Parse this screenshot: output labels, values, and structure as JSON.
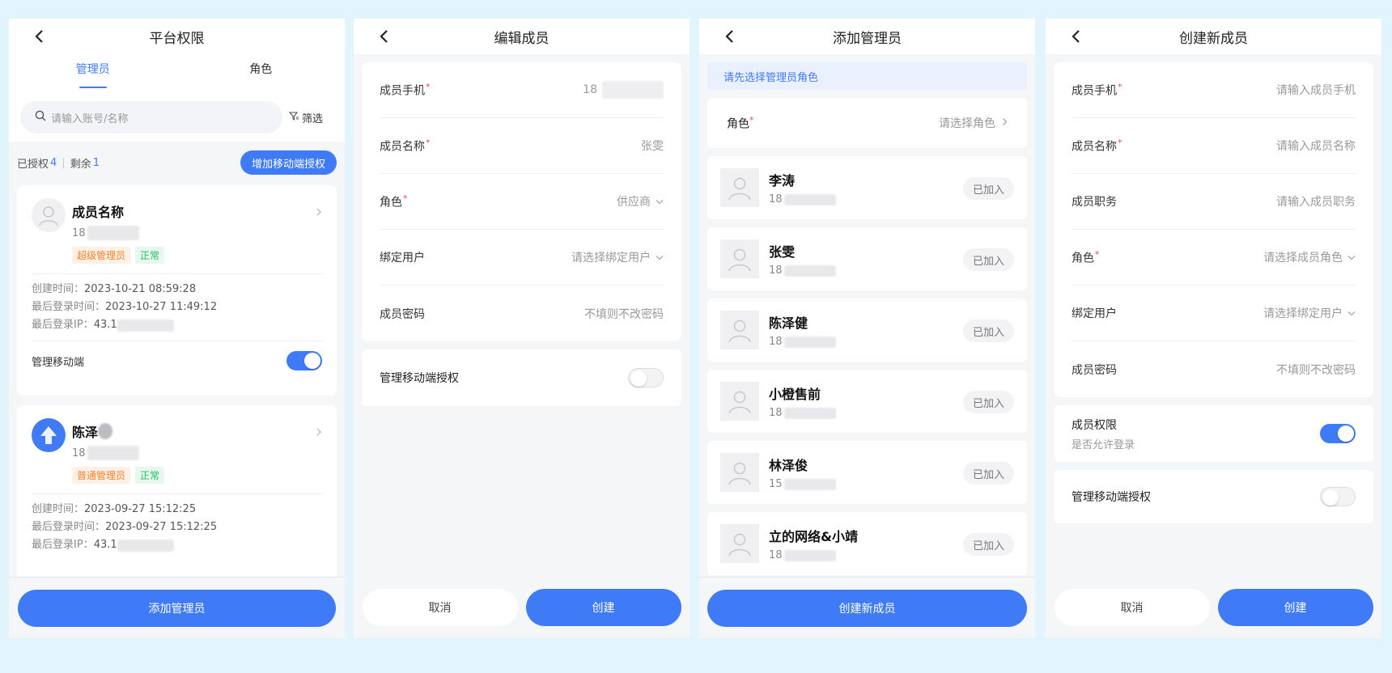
{
  "colors": {
    "accent": "#3f7bf7",
    "background": "#e2f4fc",
    "required": "#f04b4b",
    "tag_orange": "#f5812a",
    "tag_green": "#1fbf63"
  },
  "screen1": {
    "title": "平台权限",
    "tabs": [
      {
        "label": "管理员"
      },
      {
        "label": "角色"
      }
    ],
    "search_placeholder": "请输入账号/名称",
    "filter_label": "筛选",
    "authorized_label": "已授权",
    "authorized_count": "4",
    "remaining_label": "剩余",
    "remaining_count": "1",
    "add_mobile_button": "增加移动端授权",
    "cards": [
      {
        "name": "成员名称",
        "phone": "18",
        "tags": [
          "超级管理员",
          "正常"
        ],
        "created_label": "创建时间：",
        "created": "2023-10-21 08:59:28",
        "last_login_label": "最后登录时间：",
        "last_login": "2023-10-27 11:49:12",
        "ip_label": "最后登录IP：",
        "ip": "43.1",
        "mobile_label": "管理移动端",
        "mobile_enabled": true
      },
      {
        "name": "陈泽",
        "phone": "18",
        "tags": [
          "普通管理员",
          "正常"
        ],
        "created_label": "创建时间：",
        "created": "2023-09-27 15:12:25",
        "last_login_label": "最后登录时间：",
        "last_login": "2023-09-27 15:12:25",
        "ip_label": "最后登录IP：",
        "ip": "43.1"
      }
    ],
    "bottom_button": "添加管理员"
  },
  "screen2": {
    "title": "编辑成员",
    "fields": [
      {
        "label": "成员手机",
        "required": "*",
        "value": "18"
      },
      {
        "label": "成员名称",
        "required": "*",
        "value": "张雯"
      },
      {
        "label": "角色",
        "required": "*",
        "value": "供应商"
      },
      {
        "label": "绑定用户",
        "value": "请选择绑定用户"
      },
      {
        "label": "成员密码",
        "value": "不填则不改密码"
      }
    ],
    "mobile_auth_label": "管理移动端授权",
    "mobile_auth_enabled": false,
    "cancel": "取消",
    "create": "创建"
  },
  "screen3": {
    "title": "添加管理员",
    "notice": "请先选择管理员角色",
    "role_label": "角色",
    "role_required": "*",
    "role_placeholder": "请选择角色",
    "members": [
      {
        "name": "李涛",
        "phone": "18",
        "status": "已加入"
      },
      {
        "name": "张雯",
        "phone": "18",
        "status": "已加入"
      },
      {
        "name": "陈泽健",
        "phone": "18",
        "status": "已加入"
      },
      {
        "name": "小橙售前",
        "phone": "18",
        "status": "已加入"
      },
      {
        "name": "林泽俊",
        "phone": "15",
        "status": "已加入"
      },
      {
        "name": "立的网络&小靖",
        "phone": "18",
        "status": "已加入"
      }
    ],
    "bottom_button": "创建新成员"
  },
  "screen4": {
    "title": "创建新成员",
    "fields": [
      {
        "label": "成员手机",
        "required": "*",
        "placeholder": "请输入成员手机"
      },
      {
        "label": "成员名称",
        "required": "*",
        "placeholder": "请输入成员名称"
      },
      {
        "label": "成员职务",
        "placeholder": "请输入成员职务"
      },
      {
        "label": "角色",
        "required": "*",
        "placeholder": "请选择成员角色"
      },
      {
        "label": "绑定用户",
        "placeholder": "请选择绑定用户"
      },
      {
        "label": "成员密码",
        "placeholder": "不填则不改密码"
      }
    ],
    "permission_label": "成员权限",
    "permission_sub": "是否允许登录",
    "permission_enabled": true,
    "mobile_auth_label": "管理移动端授权",
    "mobile_auth_enabled": false,
    "cancel": "取消",
    "create": "创建"
  }
}
